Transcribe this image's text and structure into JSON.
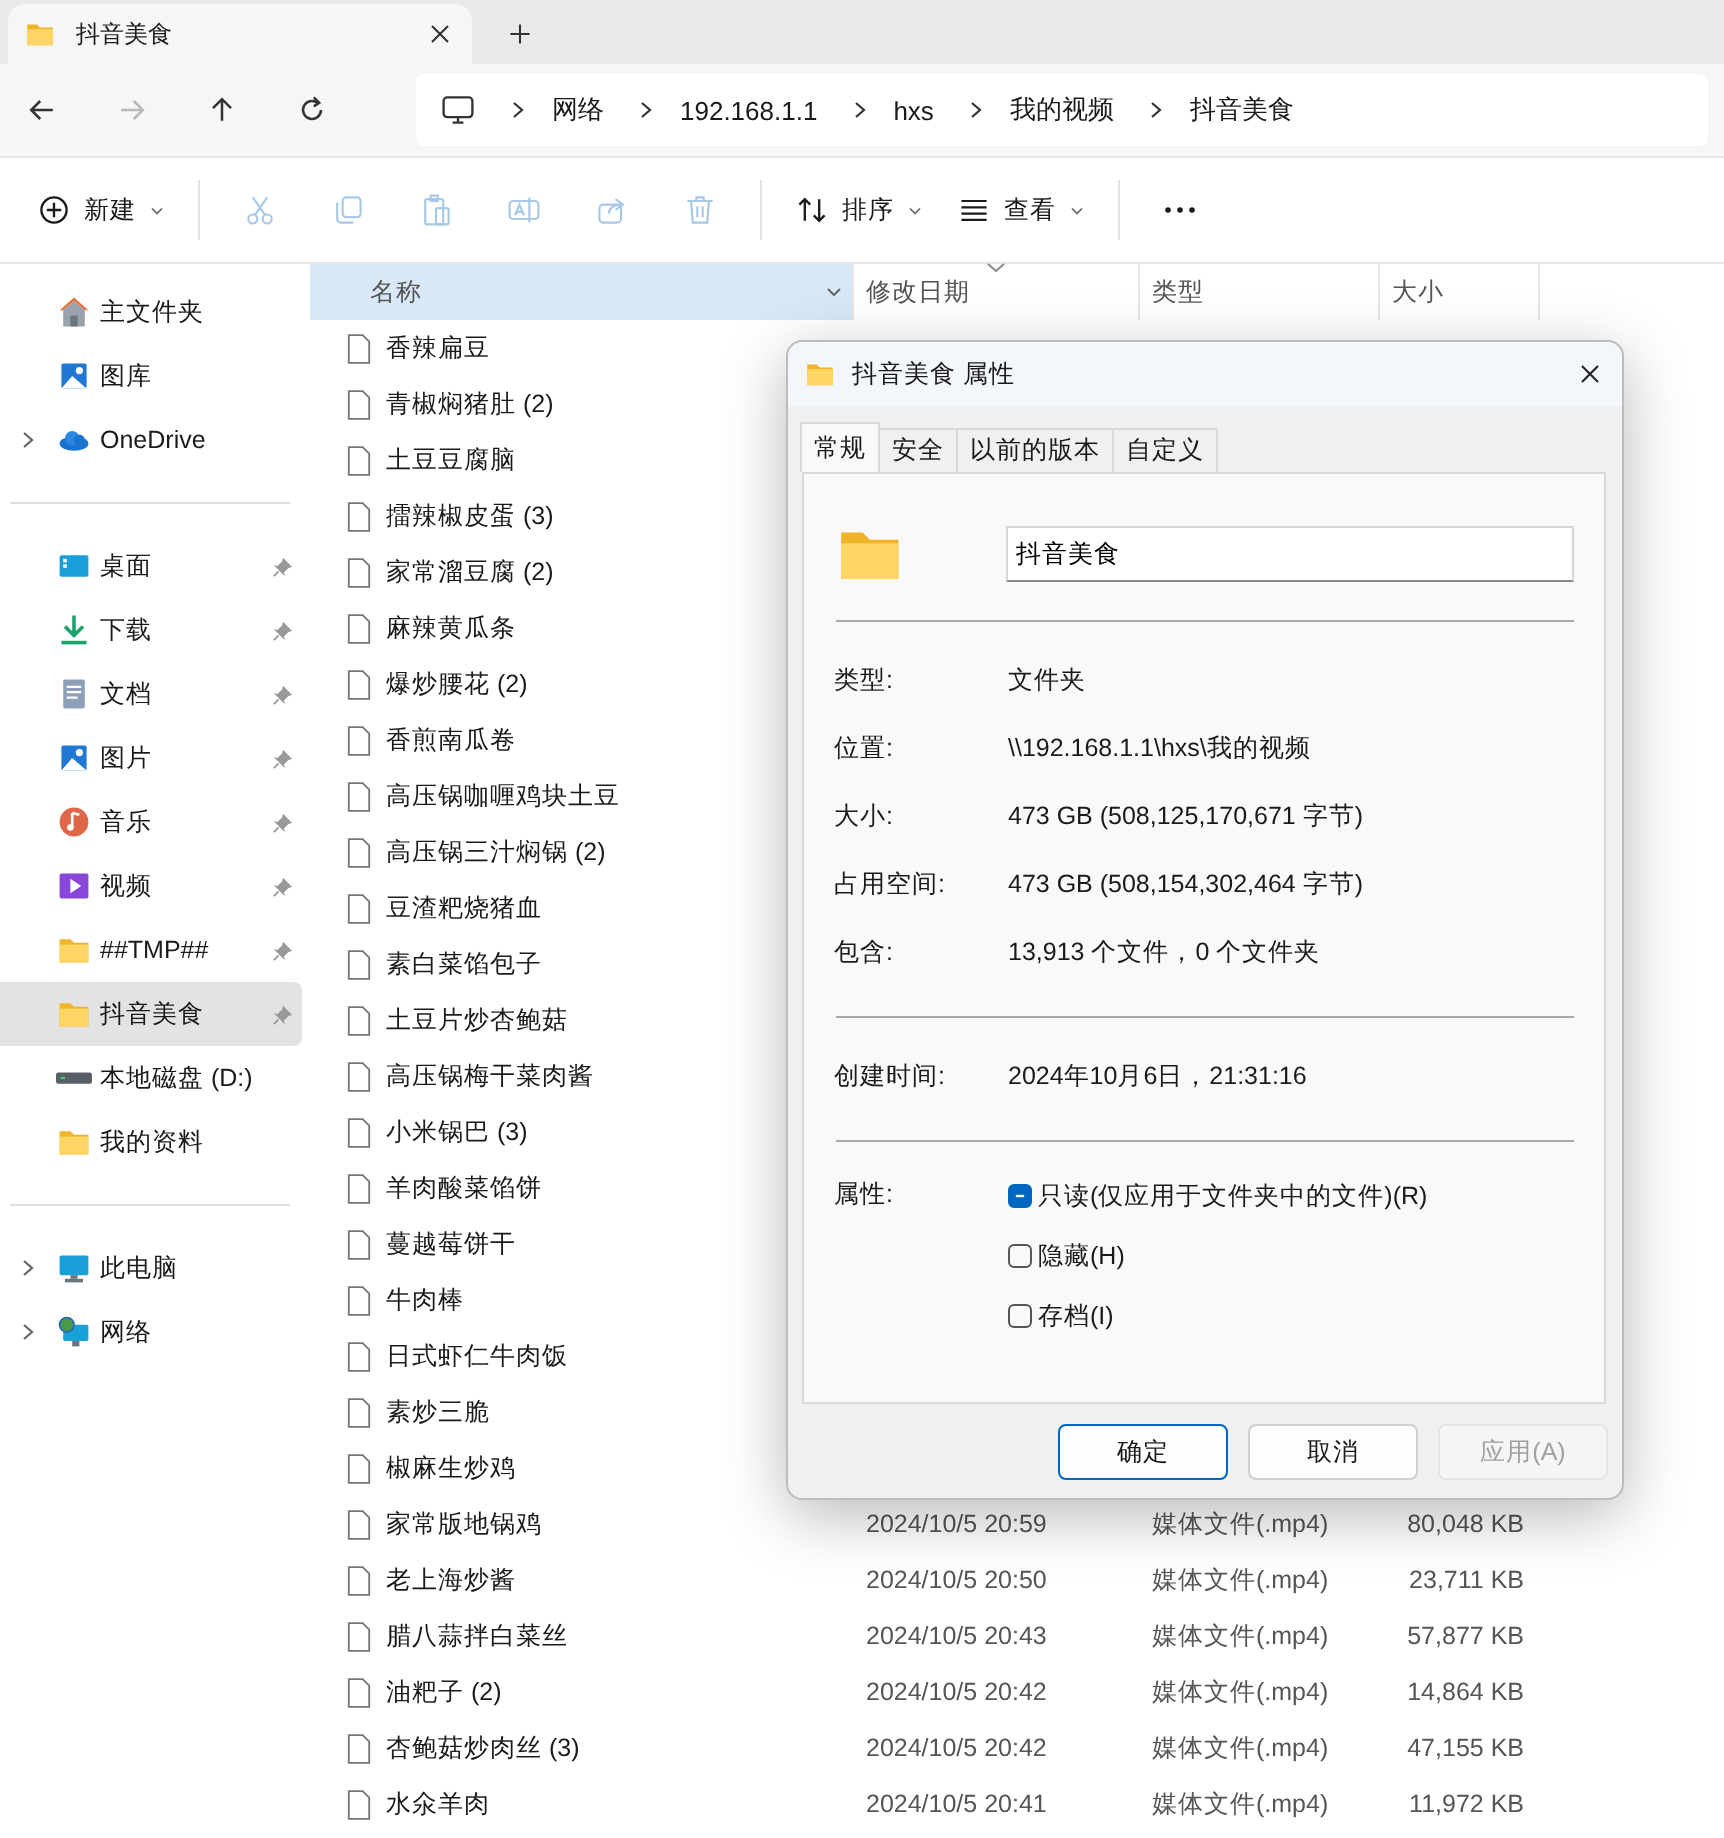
{
  "tab_bar": {
    "tabs": [
      {
        "title": "抖音美食",
        "selected": true
      }
    ]
  },
  "nav": {
    "buttons": [
      {
        "kind": "back",
        "disabled": false
      },
      {
        "kind": "forward",
        "disabled": true
      },
      {
        "kind": "up",
        "disabled": false
      },
      {
        "kind": "refresh",
        "disabled": false
      }
    ],
    "breadcrumb": [
      "网络",
      "192.168.1.1",
      "hxs",
      "我的视频",
      "抖音美食"
    ]
  },
  "toolbar": {
    "items": [
      {
        "kind": "new",
        "label": "新建",
        "disabled": false,
        "dropdown": true
      },
      {
        "kind": "cut",
        "disabled": true
      },
      {
        "kind": "copy",
        "disabled": true
      },
      {
        "kind": "paste",
        "disabled": true
      },
      {
        "kind": "rename",
        "disabled": true
      },
      {
        "kind": "share",
        "disabled": true
      },
      {
        "kind": "delete",
        "disabled": true
      },
      {
        "kind": "sort",
        "label": "排序",
        "disabled": false,
        "dropdown": true
      },
      {
        "kind": "view",
        "label": "查看",
        "disabled": false,
        "dropdown": true
      },
      {
        "kind": "more",
        "disabled": false
      }
    ]
  },
  "sidebar": {
    "groups": [
      {
        "items": [
          {
            "kind": "home",
            "label": "主文件夹",
            "selected": false
          },
          {
            "kind": "gallery",
            "label": "图库",
            "selected": false
          },
          {
            "kind": "cloud",
            "label": "OneDrive",
            "selected": false,
            "expanded": false
          }
        ]
      },
      {
        "items": [
          {
            "kind": "desktop",
            "label": "桌面",
            "selected": false,
            "pinned": true
          },
          {
            "kind": "downloads",
            "label": "下载",
            "selected": false,
            "pinned": true
          },
          {
            "kind": "documents",
            "label": "文档",
            "selected": false,
            "pinned": true
          },
          {
            "kind": "pictures",
            "label": "图片",
            "selected": false,
            "pinned": true
          },
          {
            "kind": "music",
            "label": "音乐",
            "selected": false,
            "pinned": true
          },
          {
            "kind": "videos",
            "label": "视频",
            "selected": false,
            "pinned": true
          },
          {
            "kind": "folder",
            "label": "##TMP##",
            "selected": false,
            "pinned": true
          },
          {
            "kind": "folder",
            "label": "抖音美食",
            "selected": true,
            "pinned": true
          },
          {
            "kind": "drive",
            "label": "本地磁盘 (D:)",
            "selected": false
          },
          {
            "kind": "folder",
            "label": "我的资料",
            "selected": false
          }
        ]
      },
      {
        "items": [
          {
            "kind": "pc",
            "label": "此电脑",
            "selected": false,
            "expanded": false
          },
          {
            "kind": "network",
            "label": "网络",
            "selected": false,
            "expanded": false
          }
        ]
      }
    ]
  },
  "file_list": {
    "columns": [
      {
        "label": "名称",
        "selected": true,
        "sorted": false
      },
      {
        "label": "修改日期",
        "selected": false,
        "sorted": true
      },
      {
        "label": "类型",
        "selected": false,
        "sorted": false
      },
      {
        "label": "大小",
        "selected": false,
        "sorted": false
      }
    ],
    "rows": [
      {
        "name": "香辣扁豆"
      },
      {
        "name": "青椒焖猪肚 (2)"
      },
      {
        "name": "土豆豆腐脑"
      },
      {
        "name": "擂辣椒皮蛋 (3)"
      },
      {
        "name": "家常溜豆腐 (2)"
      },
      {
        "name": "麻辣黄瓜条"
      },
      {
        "name": "爆炒腰花 (2)"
      },
      {
        "name": "香煎南瓜卷"
      },
      {
        "name": "高压锅咖喱鸡块土豆"
      },
      {
        "name": "高压锅三汁焖锅 (2)"
      },
      {
        "name": "豆渣粑烧猪血"
      },
      {
        "name": "素白菜馅包子"
      },
      {
        "name": "土豆片炒杏鲍菇"
      },
      {
        "name": "高压锅梅干菜肉酱"
      },
      {
        "name": "小米锅巴 (3)"
      },
      {
        "name": "羊肉酸菜馅饼"
      },
      {
        "name": "蔓越莓饼干"
      },
      {
        "name": "牛肉棒"
      },
      {
        "name": "日式虾仁牛肉饭"
      },
      {
        "name": "素炒三脆"
      },
      {
        "name": "椒麻生炒鸡"
      },
      {
        "name": "家常版地锅鸡",
        "date": "2024/10/5 20:59",
        "type": "媒体文件(.mp4)",
        "size": "80,048 KB"
      },
      {
        "name": "老上海炒酱",
        "date": "2024/10/5 20:50",
        "type": "媒体文件(.mp4)",
        "size": "23,711 KB"
      },
      {
        "name": "腊八蒜拌白菜丝",
        "date": "2024/10/5 20:43",
        "type": "媒体文件(.mp4)",
        "size": "57,877 KB"
      },
      {
        "name": "油粑子 (2)",
        "date": "2024/10/5 20:42",
        "type": "媒体文件(.mp4)",
        "size": "14,864 KB"
      },
      {
        "name": "杏鲍菇炒肉丝 (3)",
        "date": "2024/10/5 20:42",
        "type": "媒体文件(.mp4)",
        "size": "47,155 KB"
      },
      {
        "name": "水氽羊肉",
        "date": "2024/10/5 20:41",
        "type": "媒体文件(.mp4)",
        "size": "11,972 KB"
      }
    ]
  },
  "dialog": {
    "title": "抖音美食 属性",
    "tabs": [
      {
        "label": "常规",
        "selected": true
      },
      {
        "label": "安全",
        "selected": false
      },
      {
        "label": "以前的版本",
        "selected": false
      },
      {
        "label": "自定义",
        "selected": false
      }
    ],
    "name_field": {
      "value": "抖音美食"
    },
    "sections": [
      [
        {
          "label": "类型:",
          "value": "文件夹"
        },
        {
          "label": "位置:",
          "value": "\\\\192.168.1.1\\hxs\\我的视频"
        },
        {
          "label": "大小:",
          "value": "473 GB (508,125,170,671 字节)"
        },
        {
          "label": "占用空间:",
          "value": "473 GB (508,154,302,464 字节)"
        },
        {
          "label": "包含:",
          "value": "13,913 个文件，0 个文件夹"
        }
      ],
      [
        {
          "label": "创建时间:",
          "value": "2024年10月6日，21:31:16"
        }
      ]
    ],
    "attributes": {
      "label": "属性:",
      "options": [
        {
          "label": "只读(仅应用于文件夹中的文件)(R)",
          "indeterminate": true
        },
        {
          "label": "隐藏(H)",
          "checked": false,
          "indeterminate": false
        },
        {
          "label": "存档(I)",
          "checked": false,
          "indeterminate": false
        }
      ]
    },
    "buttons": [
      {
        "label": "确定",
        "default": true,
        "disabled": false
      },
      {
        "label": "取消",
        "default": false,
        "disabled": false
      },
      {
        "label": "应用(A)",
        "default": false,
        "disabled": true
      }
    ]
  }
}
